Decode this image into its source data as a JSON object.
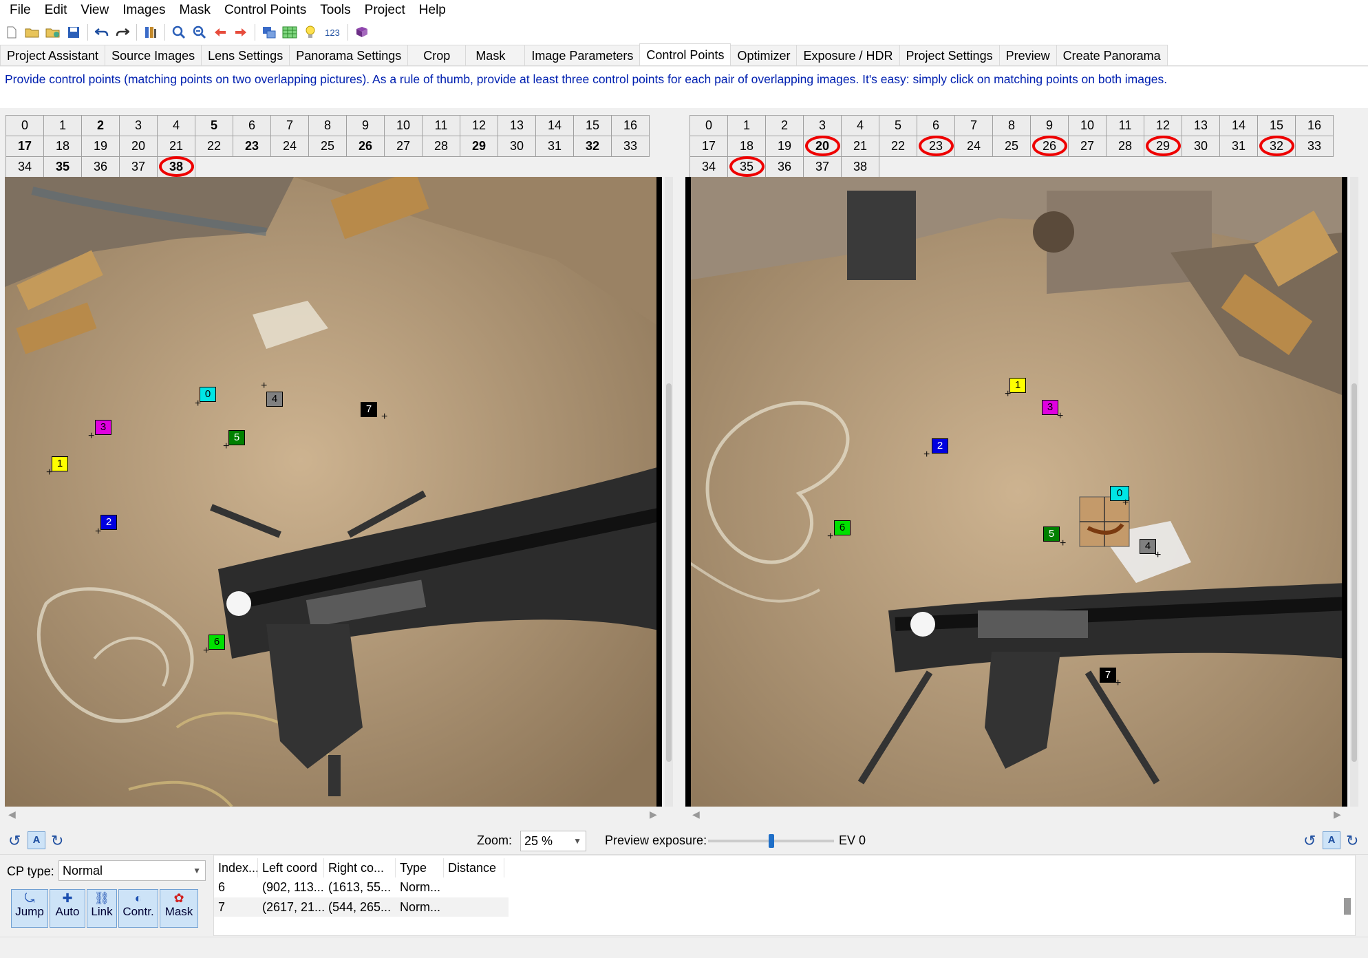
{
  "menu": [
    "File",
    "Edit",
    "View",
    "Images",
    "Mask",
    "Control Points",
    "Tools",
    "Project",
    "Help"
  ],
  "toolbar_icons": [
    "new-icon",
    "open-icon",
    "open-recent-icon",
    "save-icon",
    "undo-icon",
    "redo-icon",
    "lens-wizard-icon",
    "zoom-in-icon",
    "zoom-out-icon",
    "previous-icon",
    "next-icon",
    "show-images-icon",
    "table-icon",
    "tip-icon",
    "123-icon",
    "help-book-icon"
  ],
  "toolbar_text": {
    "counter": "123"
  },
  "tabs": [
    "Project Assistant",
    "Source Images",
    "Lens Settings",
    "Panorama Settings",
    "Crop",
    "Mask",
    "Image Parameters",
    "Control Points",
    "Optimizer",
    "Exposure / HDR",
    "Project Settings",
    "Preview",
    "Create Panorama"
  ],
  "active_tab": "Control Points",
  "info_text": "Provide control points (matching points on two overlapping pictures). As a rule of thumb, provide at least three control points for each pair of overlapping images. It's easy: simply click on matching points on both images.",
  "left_grid": {
    "labels": [
      "0",
      "1",
      "2",
      "3",
      "4",
      "5",
      "6",
      "7",
      "8",
      "9",
      "10",
      "11",
      "12",
      "13",
      "14",
      "15",
      "16",
      "17",
      "18",
      "19",
      "20",
      "21",
      "22",
      "23",
      "24",
      "25",
      "26",
      "27",
      "28",
      "29",
      "30",
      "31",
      "32",
      "33",
      "34",
      "35",
      "36",
      "37",
      "38"
    ],
    "bold": [
      "2",
      "5",
      "17",
      "23",
      "26",
      "29",
      "32",
      "35",
      "38"
    ],
    "circled": [
      "38"
    ]
  },
  "right_grid": {
    "labels": [
      "0",
      "1",
      "2",
      "3",
      "4",
      "5",
      "6",
      "7",
      "8",
      "9",
      "10",
      "11",
      "12",
      "13",
      "14",
      "15",
      "16",
      "17",
      "18",
      "19",
      "20",
      "21",
      "22",
      "23",
      "24",
      "25",
      "26",
      "27",
      "28",
      "29",
      "30",
      "31",
      "32",
      "33",
      "34",
      "35",
      "36",
      "37",
      "38"
    ],
    "bold": [
      "20"
    ],
    "circled": [
      "20",
      "23",
      "26",
      "29",
      "32",
      "35"
    ]
  },
  "left_cps": [
    "0",
    "1",
    "2",
    "3",
    "4",
    "5",
    "6",
    "7"
  ],
  "right_cps": [
    "0",
    "1",
    "2",
    "3",
    "4",
    "5",
    "6",
    "7"
  ],
  "zoom": {
    "label": "Zoom:",
    "value": "25 %"
  },
  "preview_exposure": {
    "label": "Preview exposure:",
    "value_text": "EV 0",
    "slider_fraction": 0.5
  },
  "cp_type": {
    "label": "CP type:",
    "value": "Normal"
  },
  "cp_buttons": [
    {
      "label": "Jump",
      "icon": "jump-icon"
    },
    {
      "label": "Auto",
      "icon": "auto-icon"
    },
    {
      "label": "Link",
      "icon": "link-icon"
    },
    {
      "label": "Contr.",
      "icon": "contrast-icon"
    },
    {
      "label": "Mask",
      "icon": "mask-icon"
    }
  ],
  "table": {
    "headers": [
      "Index...",
      "Left coord",
      "Right co...",
      "Type",
      "Distance"
    ],
    "rows": [
      [
        "6",
        "(902, 113...",
        "(1613, 55...",
        "Norm...",
        ""
      ],
      [
        "7",
        "(2617, 21...",
        "(544, 265...",
        "Norm...",
        ""
      ]
    ]
  },
  "rotation_buttons": {
    "left": [
      "rotate-left-icon",
      "auto-rotate-icon",
      "rotate-right-icon"
    ],
    "auto_label": "A"
  }
}
